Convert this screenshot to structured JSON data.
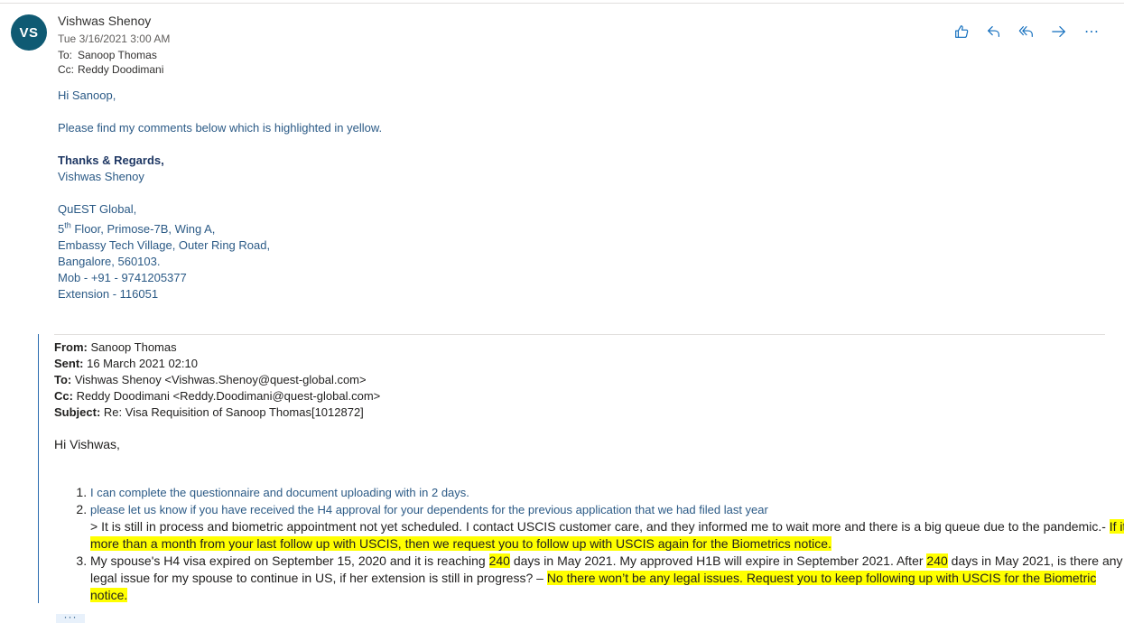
{
  "message": {
    "avatar_initials": "VS",
    "sender": "Vishwas Shenoy",
    "date": "Tue 3/16/2021 3:00 AM",
    "to_label": "To:",
    "to": "Sanoop Thomas",
    "cc_label": "Cc:",
    "cc": "Reddy Doodimani"
  },
  "toolbar": {
    "like_icon": "thumbs-up-icon",
    "reply_icon": "reply-icon",
    "reply_all_icon": "reply-all-icon",
    "forward_icon": "forward-icon",
    "more_icon": "more-actions-icon"
  },
  "body": {
    "greeting": "Hi Sanoop,",
    "line1": "Please find my comments below which is highlighted in yellow.",
    "regards": "Thanks & Regards,",
    "name": "Vishwas Shenoy",
    "company": "QuEST Global,",
    "addr1_pre": "5",
    "addr1_sup": "th",
    "addr1_post": " Floor, Primose-7B, Wing A,",
    "addr2": "Embassy Tech Village, Outer Ring Road,",
    "addr3": "Bangalore, 560103.",
    "mobile": "Mob - +91 - 9741205377",
    "extension": "Extension - 116051"
  },
  "quoted": {
    "from_label": "From:",
    "from": " Sanoop Thomas",
    "sent_label": "Sent:",
    "sent": " 16 March 2021 02:10",
    "to_label": "To:",
    "to": " Vishwas Shenoy <Vishwas.Shenoy@quest-global.com>",
    "cc_label": "Cc:",
    "cc": " Reddy Doodimani <Reddy.Doodimani@quest-global.com>",
    "subject_label": "Subject:",
    "subject": " Re: Visa Requisition of Sanoop Thomas[1012872]",
    "greeting": "Hi Vishwas,",
    "item1": "I can complete the questionnaire and document uploading with in 2 days.",
    "item2": "please let us know if you have received the H4 approval for your dependents for the previous application that we had filed last year",
    "item2_reply": "> It is still in process and biometric appointment not yet scheduled. I contact USCIS customer care, and they informed me to wait more and there is a big queue due to the pandemic.- ",
    "item2_highlight": "If it more than a month from your last follow up with USCIS, then we request you to follow up with USCIS again for the Biometrics notice.",
    "item3_a": "My spouse's H4 visa expired on September 15, 2020 and it is reaching ",
    "item3_n1": "240",
    "item3_b": " days in May 2021. My approved H1B will expire in September 2021. After ",
    "item3_n2": "240",
    "item3_c": " days in May 2021, is there any legal issue for my spouse to continue in US, if her extension is still in progress? – ",
    "item3_highlight": "No there won’t be any legal issues. Request you to keep following up with USCIS for the Biometric notice."
  },
  "more_label": "···"
}
